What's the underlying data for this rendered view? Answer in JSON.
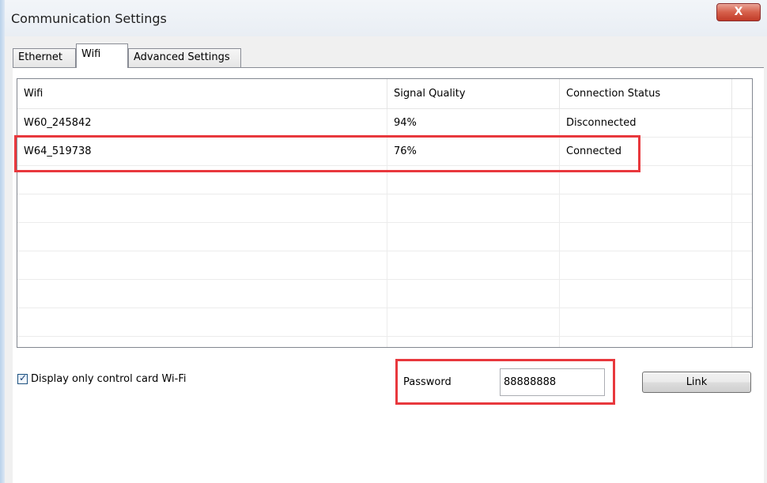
{
  "window": {
    "title": "Communication Settings",
    "close_label": "X"
  },
  "tabs": [
    {
      "label": "Ethernet"
    },
    {
      "label": "Wifi"
    },
    {
      "label": "Advanced Settings"
    }
  ],
  "table": {
    "headers": [
      "Wifi",
      "Signal Quality",
      "Connection Status"
    ],
    "rows": [
      {
        "name": "W60_245842",
        "signal": "94%",
        "status": "Disconnected"
      },
      {
        "name": "W64_519738",
        "signal": "76%",
        "status": "Connected"
      }
    ]
  },
  "options": {
    "display_only_label": "Display only control card Wi-Fi",
    "display_only_checked": true
  },
  "password": {
    "label": "Password",
    "value": "88888888"
  },
  "link_label": "Link",
  "colors": {
    "highlight": "#e8383d",
    "close": "#c13b28"
  }
}
